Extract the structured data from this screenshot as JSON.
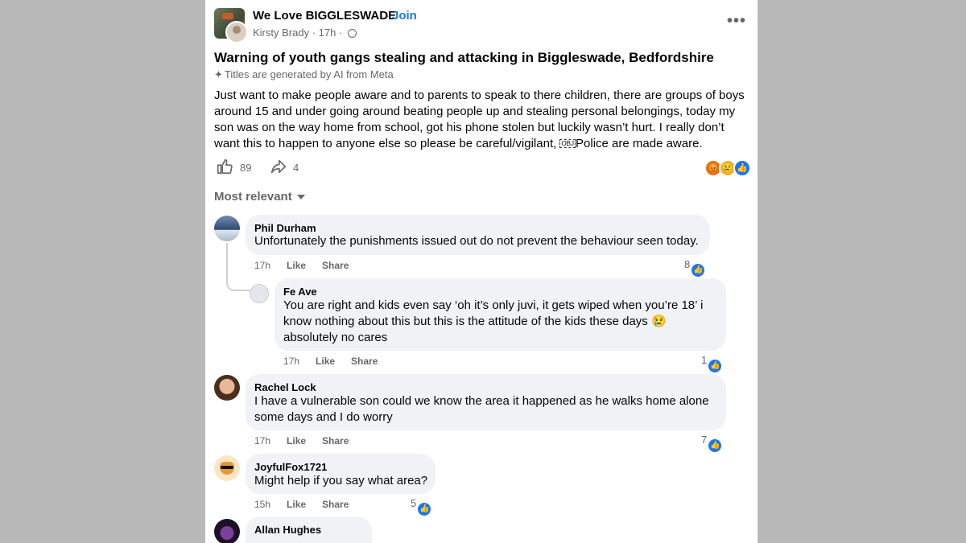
{
  "post": {
    "group_name": "We Love BIGGLESWADE",
    "separator": "·",
    "join_label": "Join",
    "author": "Kirsty Brady",
    "time": "17h",
    "title": "Warning of youth gangs stealing and attacking in Biggleswade, Bedfordshire",
    "ai_note": "Titles are generated by AI from Meta",
    "body_part1": "Just want to make people aware and to parents to speak to there children, there are groups of boys around 15 and under going around beating people up and stealing personal belongings, today my son was on the way home from school, got his phone stolen but luckily wasn’t hurt. I really don’t want this to happen to anyone else so please be careful/vigilant,",
    "obj_mark": "OBJ",
    "body_part2": "Police are made aware.",
    "likes": "89",
    "shares": "4",
    "reactions": [
      "angry",
      "sad",
      "like"
    ]
  },
  "comments_header": {
    "sort_label": "Most relevant"
  },
  "comments": [
    {
      "name": "Phil Durham",
      "text": "Unfortunately the punishments issued out do not prevent the behaviour seen today.",
      "time": "17h",
      "like": "Like",
      "share": "Share",
      "likes": "8"
    },
    {
      "name": "Fe Ave",
      "text": "You are right and kids even say ‘oh it’s only juvi, it gets wiped when you’re 18’ i know nothing about this but this is the attitude of the kids these days 😢 absolutely no cares",
      "time": "17h",
      "like": "Like",
      "share": "Share",
      "likes": "1"
    },
    {
      "name": "Rachel Lock",
      "text": "I have a vulnerable son could we know the area it happened as he walks home alone some days and I do worry",
      "time": "17h",
      "like": "Like",
      "share": "Share",
      "likes": "7"
    },
    {
      "name": "JoyfulFox1721",
      "text": "Might help if you say what area?",
      "time": "15h",
      "like": "Like",
      "share": "Share",
      "likes": "5"
    },
    {
      "name": "Allan Hughes"
    }
  ],
  "colors": {
    "accent": "#1877f2",
    "bubble": "#f0f2f5",
    "muted": "#65676b",
    "background": "#b9b9b9"
  },
  "icons": [
    "more-options-icon",
    "globe-icon",
    "ai-sparkle-icon",
    "like-outline-icon",
    "share-outline-icon",
    "angry-reaction-icon",
    "sad-reaction-icon",
    "like-reaction-icon",
    "caret-down-icon"
  ]
}
